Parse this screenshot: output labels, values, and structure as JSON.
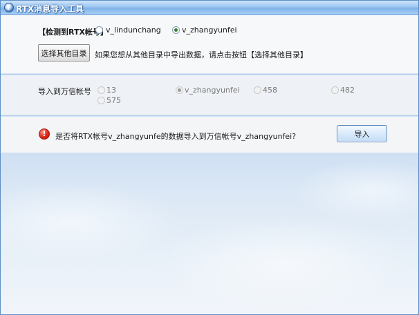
{
  "window": {
    "title": "RTX消息导入工具"
  },
  "detect": {
    "label": "【检测到RTX帐号】",
    "options": [
      {
        "label": "v_lindunchang",
        "checked": false
      },
      {
        "label": "v_zhangyunfei",
        "checked": true
      }
    ]
  },
  "choose": {
    "button_label": "选择其他目录",
    "hint": "如果您想从其他目录中导出数据，请点击按钮【选择其他目录】"
  },
  "import_to": {
    "label": "导入到万信帐号",
    "options": [
      {
        "label": "13",
        "checked": false
      },
      {
        "label": "v_zhangyunfei",
        "checked": true
      },
      {
        "label": "458",
        "checked": false
      },
      {
        "label": "482",
        "checked": false
      },
      {
        "label": "575",
        "checked": false
      }
    ]
  },
  "confirm": {
    "icon": "exclamation-icon",
    "question": "是否将RTX帐号v_zhangyunfe的数据导入到万信帐号v_zhangyunfei?",
    "import_button": "导入"
  },
  "colors": {
    "title_gradient_top": "#cfe4fb",
    "title_gradient_bottom": "#7fb2e8",
    "separator": "#a8c8ea",
    "warning_red": "#e02616"
  }
}
